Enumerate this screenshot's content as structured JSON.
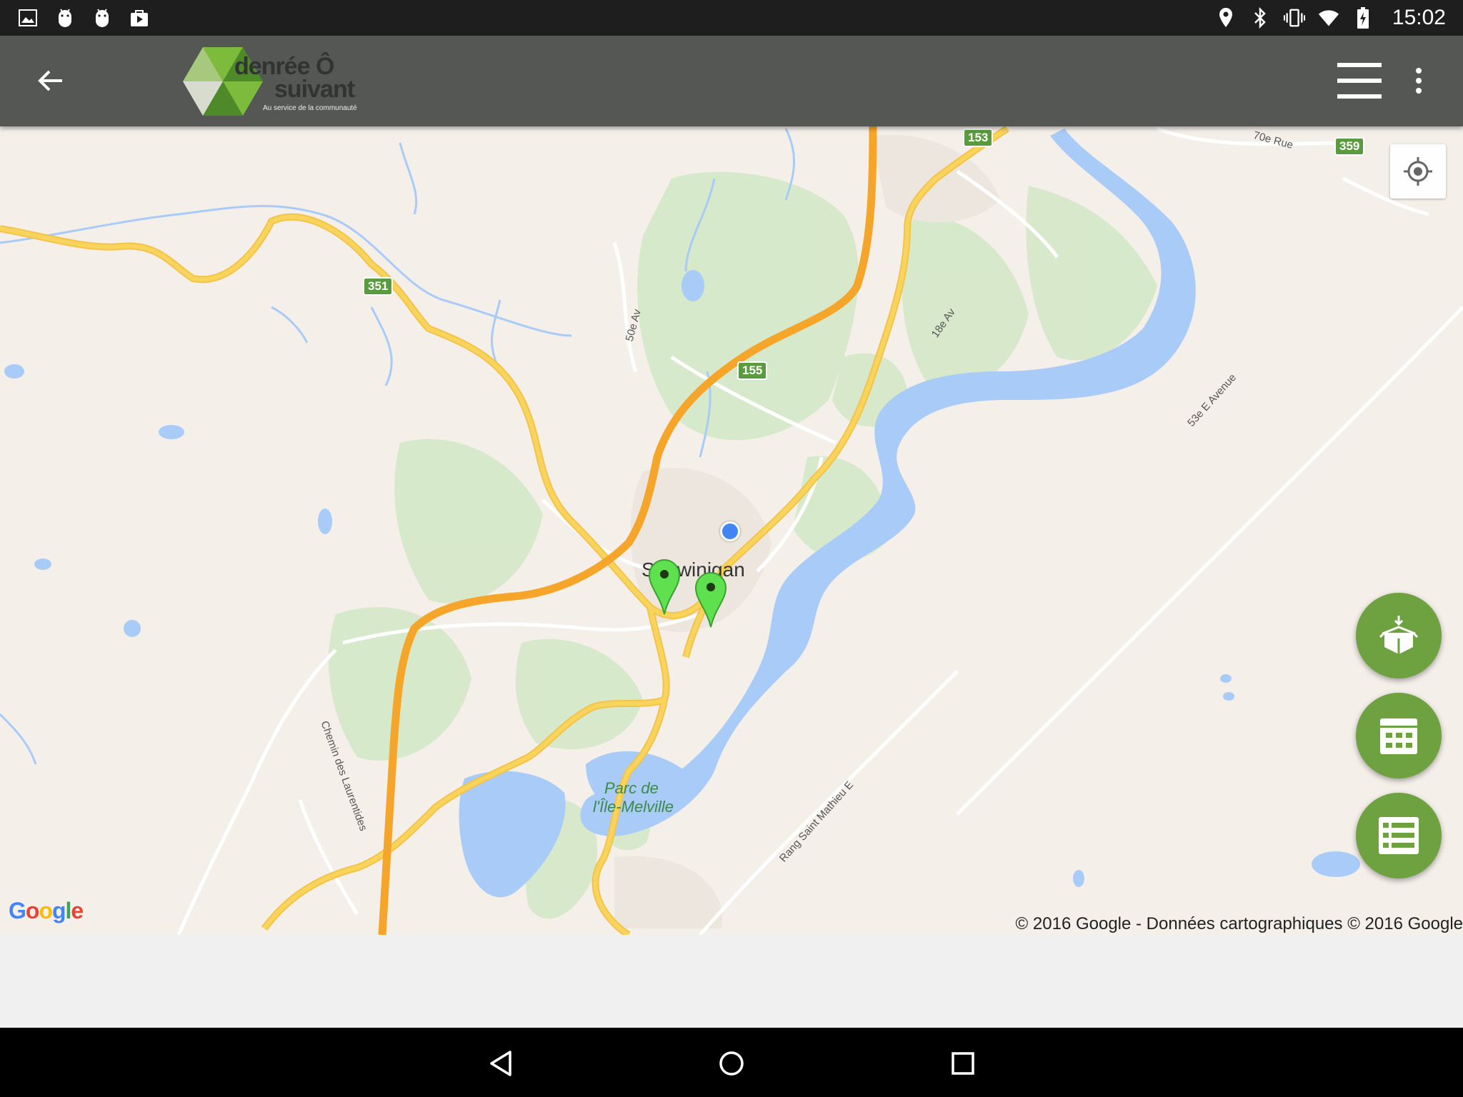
{
  "status_bar": {
    "left_icons": [
      "image-notification-icon",
      "android-debug-icon",
      "android-debug-icon-2",
      "play-store-icon"
    ],
    "right_icons": [
      "location-icon",
      "bluetooth-icon",
      "vibrate-icon",
      "wifi-icon",
      "battery-charging-icon"
    ],
    "time": "15:02"
  },
  "app_bar": {
    "back_icon": "arrow-back-icon",
    "logo": {
      "line1": "denrée Ô",
      "line2": "suivant",
      "tagline": "Au service de la communauté"
    },
    "menu_icon": "hamburger-menu-icon",
    "overflow_icon": "more-vert-icon",
    "colors": {
      "bar": "#545753",
      "logo_green": "#7dbb3c",
      "logo_dark_green": "#4f8a2a"
    }
  },
  "map": {
    "labels": {
      "city": "Shawinigan",
      "park_line1": "Parc de",
      "park_line2": "l'Île-Melville",
      "road_50e": "50e Av",
      "road_18e": "18e Av",
      "road_70e": "70e Rue",
      "road_53e": "53e E Avenue",
      "road_chemin": "Chemin des Laurentides",
      "road_rang": "Rang Saint Mathieu E"
    },
    "shields": {
      "r351": "351",
      "r155": "155",
      "r153": "153",
      "r359": "359"
    },
    "markers": [
      "place-marker",
      "place-marker"
    ],
    "current_location": "my-location-dot",
    "attribution": "© 2016 Google - Données cartographiques © 2016 Google",
    "google_logo": "Google",
    "colors": {
      "land": "#f5efe9",
      "water": "#a9cbf7",
      "park": "#cfe6c2",
      "highway": "#f5a52a",
      "road": "#f9d45c",
      "marker": "#5fe04f",
      "fab": "#6ea240"
    }
  },
  "fabs": {
    "donate_icon": "box-donate-icon",
    "calendar_icon": "calendar-grid-icon",
    "list_icon": "list-view-icon"
  },
  "locate_icon": "my-location-target-icon",
  "nav_bar": {
    "back_icon": "nav-back-icon",
    "home_icon": "nav-home-icon",
    "recents_icon": "nav-recents-icon"
  }
}
